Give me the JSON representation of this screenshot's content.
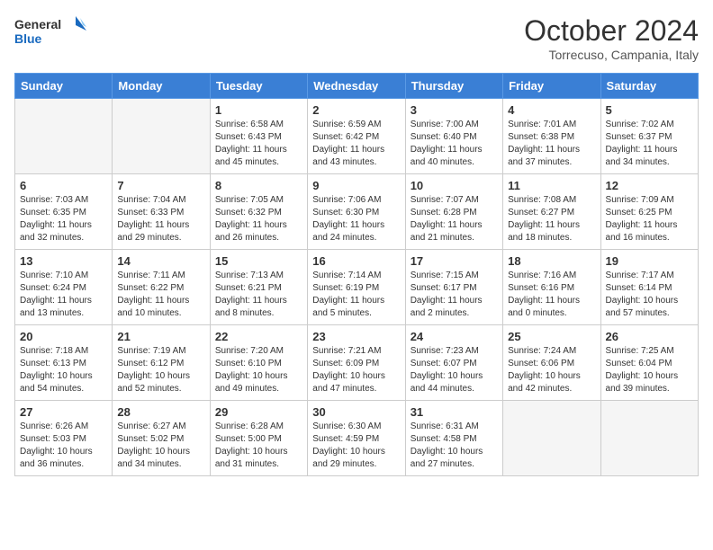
{
  "header": {
    "logo_line1": "General",
    "logo_line2": "Blue",
    "month_title": "October 2024",
    "subtitle": "Torrecuso, Campania, Italy"
  },
  "weekdays": [
    "Sunday",
    "Monday",
    "Tuesday",
    "Wednesday",
    "Thursday",
    "Friday",
    "Saturday"
  ],
  "weeks": [
    [
      {
        "day": "",
        "detail": ""
      },
      {
        "day": "",
        "detail": ""
      },
      {
        "day": "1",
        "detail": "Sunrise: 6:58 AM\nSunset: 6:43 PM\nDaylight: 11 hours and 45 minutes."
      },
      {
        "day": "2",
        "detail": "Sunrise: 6:59 AM\nSunset: 6:42 PM\nDaylight: 11 hours and 43 minutes."
      },
      {
        "day": "3",
        "detail": "Sunrise: 7:00 AM\nSunset: 6:40 PM\nDaylight: 11 hours and 40 minutes."
      },
      {
        "day": "4",
        "detail": "Sunrise: 7:01 AM\nSunset: 6:38 PM\nDaylight: 11 hours and 37 minutes."
      },
      {
        "day": "5",
        "detail": "Sunrise: 7:02 AM\nSunset: 6:37 PM\nDaylight: 11 hours and 34 minutes."
      }
    ],
    [
      {
        "day": "6",
        "detail": "Sunrise: 7:03 AM\nSunset: 6:35 PM\nDaylight: 11 hours and 32 minutes."
      },
      {
        "day": "7",
        "detail": "Sunrise: 7:04 AM\nSunset: 6:33 PM\nDaylight: 11 hours and 29 minutes."
      },
      {
        "day": "8",
        "detail": "Sunrise: 7:05 AM\nSunset: 6:32 PM\nDaylight: 11 hours and 26 minutes."
      },
      {
        "day": "9",
        "detail": "Sunrise: 7:06 AM\nSunset: 6:30 PM\nDaylight: 11 hours and 24 minutes."
      },
      {
        "day": "10",
        "detail": "Sunrise: 7:07 AM\nSunset: 6:28 PM\nDaylight: 11 hours and 21 minutes."
      },
      {
        "day": "11",
        "detail": "Sunrise: 7:08 AM\nSunset: 6:27 PM\nDaylight: 11 hours and 18 minutes."
      },
      {
        "day": "12",
        "detail": "Sunrise: 7:09 AM\nSunset: 6:25 PM\nDaylight: 11 hours and 16 minutes."
      }
    ],
    [
      {
        "day": "13",
        "detail": "Sunrise: 7:10 AM\nSunset: 6:24 PM\nDaylight: 11 hours and 13 minutes."
      },
      {
        "day": "14",
        "detail": "Sunrise: 7:11 AM\nSunset: 6:22 PM\nDaylight: 11 hours and 10 minutes."
      },
      {
        "day": "15",
        "detail": "Sunrise: 7:13 AM\nSunset: 6:21 PM\nDaylight: 11 hours and 8 minutes."
      },
      {
        "day": "16",
        "detail": "Sunrise: 7:14 AM\nSunset: 6:19 PM\nDaylight: 11 hours and 5 minutes."
      },
      {
        "day": "17",
        "detail": "Sunrise: 7:15 AM\nSunset: 6:17 PM\nDaylight: 11 hours and 2 minutes."
      },
      {
        "day": "18",
        "detail": "Sunrise: 7:16 AM\nSunset: 6:16 PM\nDaylight: 11 hours and 0 minutes."
      },
      {
        "day": "19",
        "detail": "Sunrise: 7:17 AM\nSunset: 6:14 PM\nDaylight: 10 hours and 57 minutes."
      }
    ],
    [
      {
        "day": "20",
        "detail": "Sunrise: 7:18 AM\nSunset: 6:13 PM\nDaylight: 10 hours and 54 minutes."
      },
      {
        "day": "21",
        "detail": "Sunrise: 7:19 AM\nSunset: 6:12 PM\nDaylight: 10 hours and 52 minutes."
      },
      {
        "day": "22",
        "detail": "Sunrise: 7:20 AM\nSunset: 6:10 PM\nDaylight: 10 hours and 49 minutes."
      },
      {
        "day": "23",
        "detail": "Sunrise: 7:21 AM\nSunset: 6:09 PM\nDaylight: 10 hours and 47 minutes."
      },
      {
        "day": "24",
        "detail": "Sunrise: 7:23 AM\nSunset: 6:07 PM\nDaylight: 10 hours and 44 minutes."
      },
      {
        "day": "25",
        "detail": "Sunrise: 7:24 AM\nSunset: 6:06 PM\nDaylight: 10 hours and 42 minutes."
      },
      {
        "day": "26",
        "detail": "Sunrise: 7:25 AM\nSunset: 6:04 PM\nDaylight: 10 hours and 39 minutes."
      }
    ],
    [
      {
        "day": "27",
        "detail": "Sunrise: 6:26 AM\nSunset: 5:03 PM\nDaylight: 10 hours and 36 minutes."
      },
      {
        "day": "28",
        "detail": "Sunrise: 6:27 AM\nSunset: 5:02 PM\nDaylight: 10 hours and 34 minutes."
      },
      {
        "day": "29",
        "detail": "Sunrise: 6:28 AM\nSunset: 5:00 PM\nDaylight: 10 hours and 31 minutes."
      },
      {
        "day": "30",
        "detail": "Sunrise: 6:30 AM\nSunset: 4:59 PM\nDaylight: 10 hours and 29 minutes."
      },
      {
        "day": "31",
        "detail": "Sunrise: 6:31 AM\nSunset: 4:58 PM\nDaylight: 10 hours and 27 minutes."
      },
      {
        "day": "",
        "detail": ""
      },
      {
        "day": "",
        "detail": ""
      }
    ]
  ]
}
